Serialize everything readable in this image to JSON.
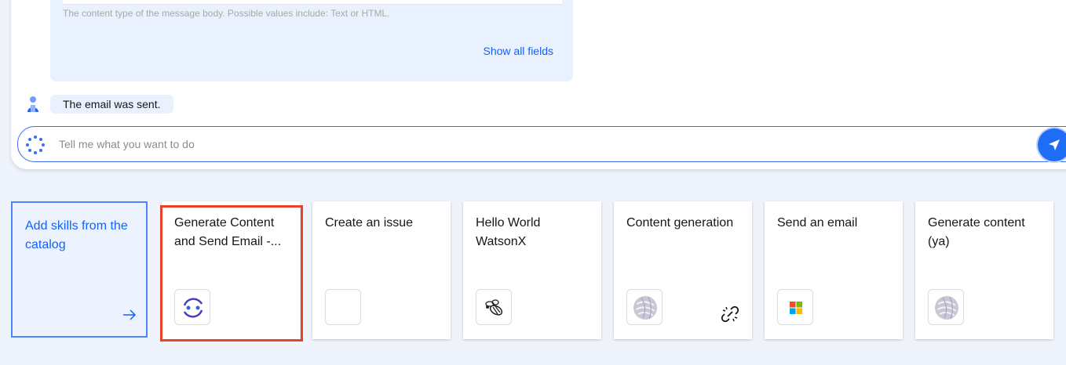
{
  "form": {
    "helper_text": "The content type of the message body. Possible values include: Text or HTML.",
    "show_all_label": "Show all fields"
  },
  "message": {
    "text": "The email was sent."
  },
  "input": {
    "placeholder": "Tell me what you want to do"
  },
  "catalog": {
    "label": "Add skills from the catalog"
  },
  "skills": [
    {
      "title": "Generate Content and Send Email -...",
      "icon": "flow-icon"
    },
    {
      "title": "Create an issue",
      "icon": "blank-icon"
    },
    {
      "title": "Hello World WatsonX",
      "icon": "bee-icon"
    },
    {
      "title": "Content generation",
      "icon": "sphere-icon"
    },
    {
      "title": "Send an email",
      "icon": "microsoft-icon"
    },
    {
      "title": "Generate content (ya)",
      "icon": "sphere-icon"
    }
  ],
  "colors": {
    "accent": "#0f62fe",
    "highlight": "#e8412c",
    "background": "#eef3fc"
  }
}
